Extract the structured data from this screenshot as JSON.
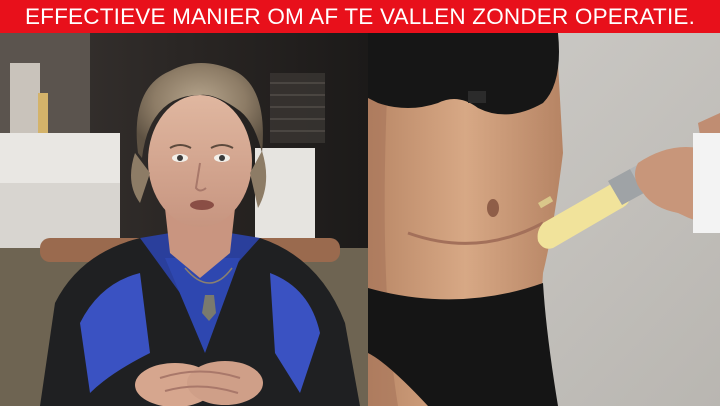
{
  "banner": {
    "headline": "EFFECTIEVE MANIER OM AF TE VALLEN ZONDER OPERATIE.",
    "background_color": "#e8101b",
    "text_color": "#ffffff"
  },
  "left_photo": {
    "subject": "woman-portrait",
    "icons": [
      "pendant-necklace-icon",
      "clasped-hands-icon"
    ]
  },
  "right_photo": {
    "subject": "abdomen-injection",
    "icons": [
      "syringe-icon",
      "hand-icon"
    ]
  }
}
